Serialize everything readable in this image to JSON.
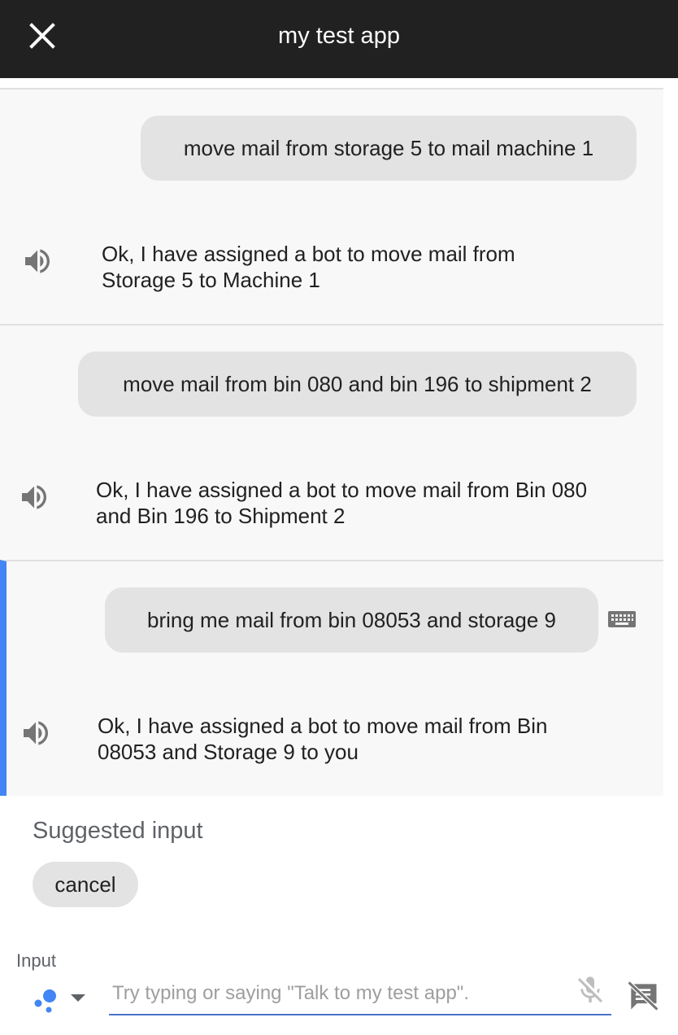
{
  "header": {
    "title": "my test app"
  },
  "turns": [
    {
      "query": "move mail from storage 5 to mail machine 1",
      "response": "Ok, I have assigned a bot to move mail from Storage 5 to Machine 1"
    },
    {
      "query": "move mail from bin 080 and bin 196 to shipment 2",
      "response": "Ok, I have assigned a bot to move mail from Bin 080 and Bin 196 to Shipment 2"
    },
    {
      "query": "bring me mail from bin 08053 and storage 9",
      "response": "Ok, I have assigned a bot to move mail from Bin 08053 and Storage 9 to you"
    }
  ],
  "suggestions": {
    "title": "Suggested input",
    "chips": [
      "cancel"
    ]
  },
  "input": {
    "label": "Input",
    "placeholder": "Try typing or saying \"Talk to my test app\"."
  },
  "colors": {
    "header_bg": "#212121",
    "accent": "#4285f4",
    "bubble_bg": "#e3e3e3",
    "turn_bg": "#f8f8f8"
  },
  "icons": [
    "close-icon",
    "speaker-icon",
    "keyboard-icon",
    "assistant-icon",
    "dropdown-arrow-icon",
    "microphone-off-icon",
    "chat-off-icon"
  ]
}
